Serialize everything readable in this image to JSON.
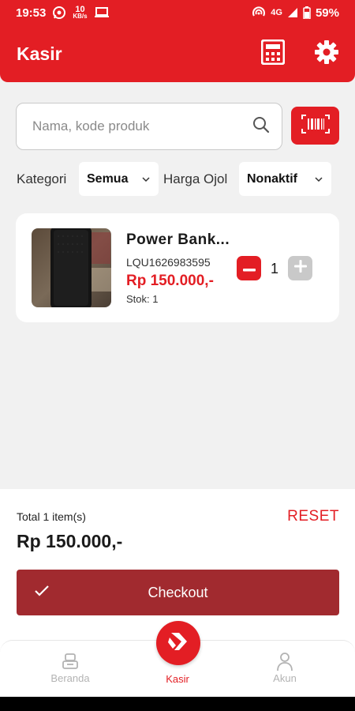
{
  "status_bar": {
    "time": "19:53",
    "speed_value": "10",
    "speed_unit": "KB/s",
    "network": "4G",
    "battery": "59%"
  },
  "app_bar": {
    "title": "Kasir",
    "calculator_icon": "calculator-icon",
    "settings_icon": "gear-icon"
  },
  "search": {
    "placeholder": "Nama, kode produk",
    "value": ""
  },
  "filters": {
    "category_label": "Kategori",
    "category_value": "Semua",
    "ojol_label": "Harga Ojol",
    "ojol_value": "Nonaktif"
  },
  "products": [
    {
      "name": "Power Bank...",
      "code": "LQU1626983595",
      "price": "Rp 150.000,-",
      "stock": "Stok: 1",
      "quantity": "1"
    }
  ],
  "summary": {
    "total_label": "Total 1 item(s)",
    "reset_label": "RESET",
    "total_value": "Rp 150.000,-",
    "checkout_label": "Checkout"
  },
  "bottom_nav": {
    "items": [
      {
        "label": "Beranda",
        "icon": "cashier-icon"
      },
      {
        "label": "Kasir",
        "icon": "kasir-logo-icon"
      },
      {
        "label": "Akun",
        "icon": "user-icon"
      }
    ]
  },
  "colors": {
    "primary": "#e31e24",
    "checkout": "#a12a2f",
    "background": "#f1f1f1"
  }
}
